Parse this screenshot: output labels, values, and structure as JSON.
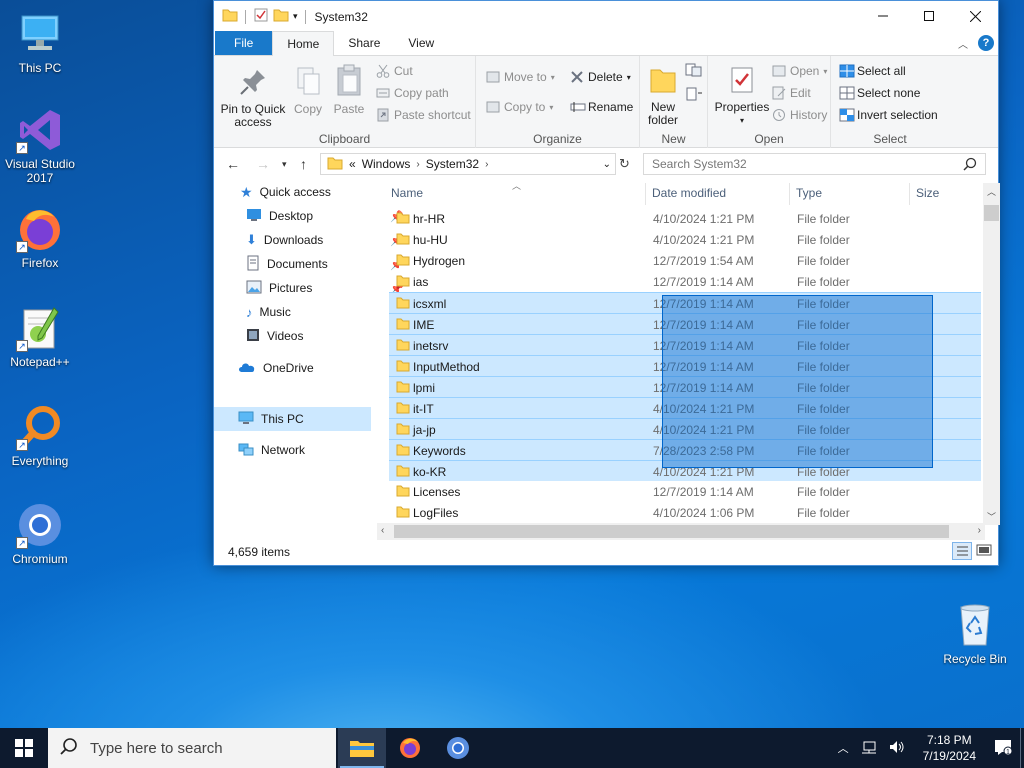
{
  "desktop": {
    "icons": [
      {
        "label": "This PC"
      },
      {
        "label": "Visual Studio 2017"
      },
      {
        "label": "Firefox"
      },
      {
        "label": "Notepad++"
      },
      {
        "label": "Everything"
      },
      {
        "label": "Chromium"
      },
      {
        "label": "Recycle Bin"
      }
    ]
  },
  "window": {
    "title": "System32",
    "tabs": [
      "File",
      "Home",
      "Share",
      "View"
    ],
    "ribbon": {
      "clipboard": {
        "pin": "Pin to Quick access",
        "copy": "Copy",
        "paste": "Paste",
        "cut": "Cut",
        "copy_path": "Copy path",
        "paste_shortcut": "Paste shortcut",
        "label": "Clipboard"
      },
      "organize": {
        "move_to": "Move to",
        "copy_to": "Copy to",
        "delete": "Delete",
        "rename": "Rename",
        "label": "Organize"
      },
      "new": {
        "new_folder": "New folder",
        "label": "New"
      },
      "open": {
        "properties": "Properties",
        "open": "Open",
        "edit": "Edit",
        "history": "History",
        "label": "Open"
      },
      "select": {
        "select_all": "Select all",
        "select_none": "Select none",
        "invert": "Invert selection",
        "label": "Select"
      }
    },
    "address": {
      "prefix": "«",
      "parts": [
        "Windows",
        "System32"
      ]
    },
    "search_placeholder": "Search System32",
    "nav": [
      {
        "label": "Quick access"
      },
      {
        "label": "Desktop"
      },
      {
        "label": "Downloads"
      },
      {
        "label": "Documents"
      },
      {
        "label": "Pictures"
      },
      {
        "label": "Music"
      },
      {
        "label": "Videos"
      },
      {
        "label": "OneDrive"
      },
      {
        "label": "This PC"
      },
      {
        "label": "Network"
      }
    ],
    "columns": [
      "Name",
      "Date modified",
      "Type",
      "Size"
    ],
    "files": [
      {
        "name": "hr-HR",
        "date": "4/10/2024 1:21 PM",
        "type": "File folder",
        "selected": false
      },
      {
        "name": "hu-HU",
        "date": "4/10/2024 1:21 PM",
        "type": "File folder",
        "selected": false
      },
      {
        "name": "Hydrogen",
        "date": "12/7/2019 1:54 AM",
        "type": "File folder",
        "selected": false
      },
      {
        "name": "ias",
        "date": "12/7/2019 1:14 AM",
        "type": "File folder",
        "selected": false
      },
      {
        "name": "icsxml",
        "date": "12/7/2019 1:14 AM",
        "type": "File folder",
        "selected": true
      },
      {
        "name": "IME",
        "date": "12/7/2019 1:14 AM",
        "type": "File folder",
        "selected": true
      },
      {
        "name": "inetsrv",
        "date": "12/7/2019 1:14 AM",
        "type": "File folder",
        "selected": true
      },
      {
        "name": "InputMethod",
        "date": "12/7/2019 1:14 AM",
        "type": "File folder",
        "selected": true
      },
      {
        "name": "lpmi",
        "date": "12/7/2019 1:14 AM",
        "type": "File folder",
        "selected": true
      },
      {
        "name": "it-IT",
        "date": "4/10/2024 1:21 PM",
        "type": "File folder",
        "selected": true
      },
      {
        "name": "ja-jp",
        "date": "4/10/2024 1:21 PM",
        "type": "File folder",
        "selected": true
      },
      {
        "name": "Keywords",
        "date": "7/28/2023 2:58 PM",
        "type": "File folder",
        "selected": true
      },
      {
        "name": "ko-KR",
        "date": "4/10/2024 1:21 PM",
        "type": "File folder",
        "selected": true
      },
      {
        "name": "Licenses",
        "date": "12/7/2019 1:14 AM",
        "type": "File folder",
        "selected": false
      },
      {
        "name": "LogFiles",
        "date": "4/10/2024 1:06 PM",
        "type": "File folder",
        "selected": false
      }
    ],
    "status": "4,659 items"
  },
  "taskbar": {
    "search_placeholder": "Type here to search",
    "time": "7:18 PM",
    "date": "7/19/2024"
  }
}
